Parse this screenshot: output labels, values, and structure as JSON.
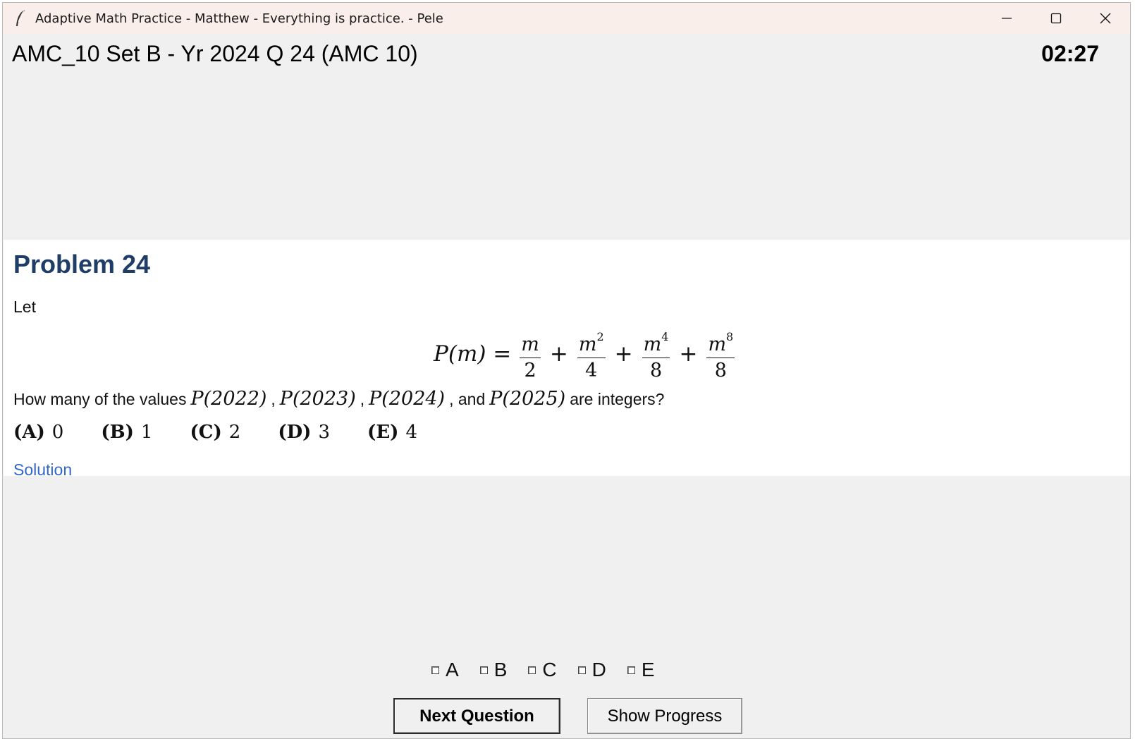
{
  "window": {
    "title": "Adaptive Math Practice - Matthew - Everything is practice. - Pele",
    "icons": [
      "feather-icon",
      "minimize-icon",
      "maximize-icon",
      "close-icon"
    ]
  },
  "header": {
    "set_title": "AMC_10 Set B - Yr 2024 Q 24 (AMC 10)",
    "timer": "02:27"
  },
  "problem": {
    "heading": "Problem 24",
    "intro": "Let",
    "formula": {
      "lhs": "P(m) =",
      "terms": [
        {
          "num_base": "m",
          "num_exp": "",
          "den": "2"
        },
        {
          "num_base": "m",
          "num_exp": "2",
          "den": "4"
        },
        {
          "num_base": "m",
          "num_exp": "4",
          "den": "8"
        },
        {
          "num_base": "m",
          "num_exp": "8",
          "den": "8"
        }
      ],
      "plus": "+"
    },
    "question": {
      "prefix": "How many of the values",
      "v1": "P(2022)",
      "v2": "P(2023)",
      "v3": "P(2024)",
      "v4": "P(2025)",
      "comma": ",",
      "and": ", and",
      "suffix": "are integers?"
    },
    "choices": [
      {
        "letter": "(A)",
        "value": "0"
      },
      {
        "letter": "(B)",
        "value": "1"
      },
      {
        "letter": "(C)",
        "value": "2"
      },
      {
        "letter": "(D)",
        "value": "3"
      },
      {
        "letter": "(E)",
        "value": "4"
      }
    ],
    "solution_link": "Solution"
  },
  "answers": {
    "options": [
      "A",
      "B",
      "C",
      "D",
      "E"
    ]
  },
  "buttons": {
    "next": "Next Question",
    "progress": "Show Progress"
  }
}
